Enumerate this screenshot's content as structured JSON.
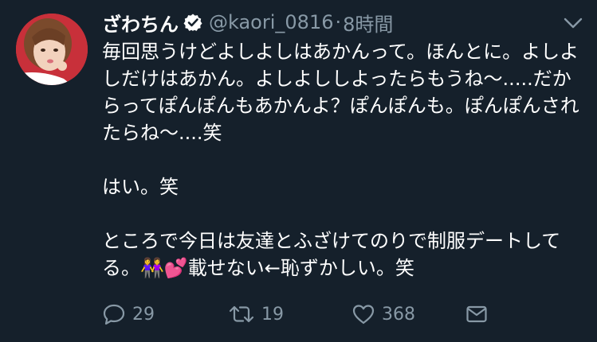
{
  "tweet": {
    "display_name": "ざわちん",
    "handle": "@kaori_0816",
    "separator": "·",
    "time": "8時間",
    "paragraphs": [
      "毎回思うけどよしよしはあかんって。ほんとに。よしよしだけはあかん。よしよししよったらもうね〜.....だからってぽんぽんもあかんよ？ぽんぽんも。ぽんぽんされたらね〜....笑",
      "はい。笑",
      "ところで今日は友達とふざけてのりで制服デートしてる。👭💕載せない←恥ずかしい。笑"
    ]
  },
  "actions": {
    "reply_count": "29",
    "retweet_count": "19",
    "like_count": "368"
  },
  "icons": {
    "verified": "verified-badge-icon",
    "caret": "chevron-down-icon",
    "reply": "reply-icon",
    "retweet": "retweet-icon",
    "like": "heart-icon",
    "dm": "mail-icon"
  },
  "colors": {
    "background": "#15202b",
    "text": "#ffffff",
    "secondary": "#8899a6"
  }
}
